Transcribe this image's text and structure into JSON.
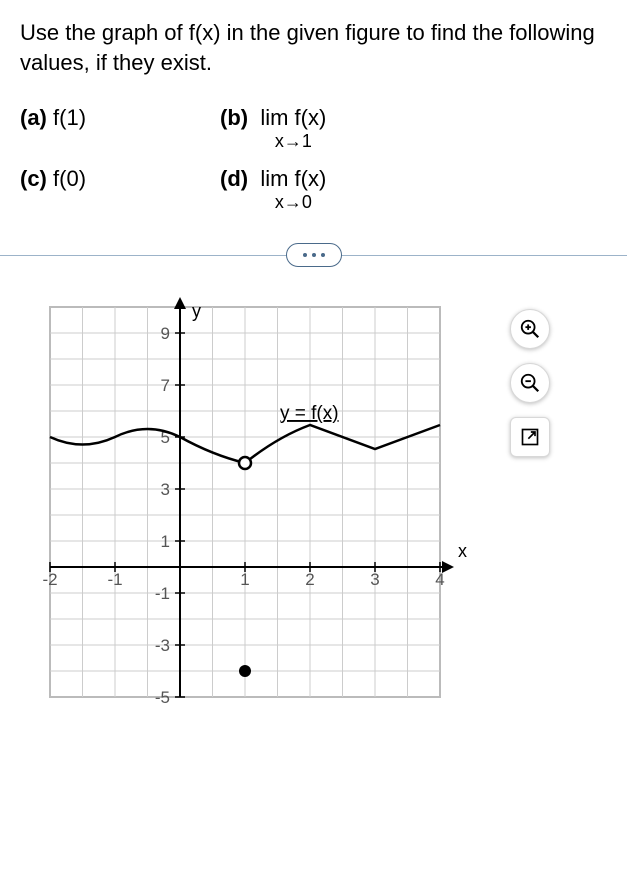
{
  "prompt": "Use the graph of f(x) in the given figure to find the following values, if they exist.",
  "parts": {
    "a": {
      "label": "(a)",
      "text": "f(1)"
    },
    "b": {
      "label": "(b)",
      "lim": "lim f(x)",
      "sub": "x→1"
    },
    "c": {
      "label": "(c)",
      "text": "f(0)"
    },
    "d": {
      "label": "(d)",
      "lim": "lim f(x)",
      "sub": "x→0"
    }
  },
  "axis": {
    "y_label": "y",
    "x_label": "x",
    "func_label": "y = f(x)",
    "y_ticks": [
      9,
      7,
      5,
      3,
      1,
      -1,
      -3,
      -5
    ],
    "x_ticks_neg": [
      -2,
      -1
    ],
    "x_ticks_pos": [
      1,
      2,
      3,
      4
    ]
  },
  "chart_data": {
    "type": "line",
    "title": "y = f(x)",
    "xlabel": "x",
    "ylabel": "y",
    "xlim": [
      -2,
      4
    ],
    "ylim": [
      -5,
      10
    ],
    "series": [
      {
        "name": "f(x)",
        "x": [
          -2,
          -1.5,
          -1,
          -0.5,
          0,
          0.5,
          1,
          1.5,
          2,
          2.5,
          3,
          3.5,
          4
        ],
        "y": [
          5,
          4.5,
          5,
          5.5,
          5,
          4.5,
          4,
          4.8,
          5.5,
          5.1,
          4.6,
          5,
          5.5
        ]
      }
    ],
    "points": [
      {
        "x": 1,
        "y": 4,
        "type": "open",
        "note": "limit value, f not defined here by curve"
      },
      {
        "x": 1,
        "y": -4,
        "type": "closed",
        "note": "f(1) defined value"
      }
    ]
  }
}
